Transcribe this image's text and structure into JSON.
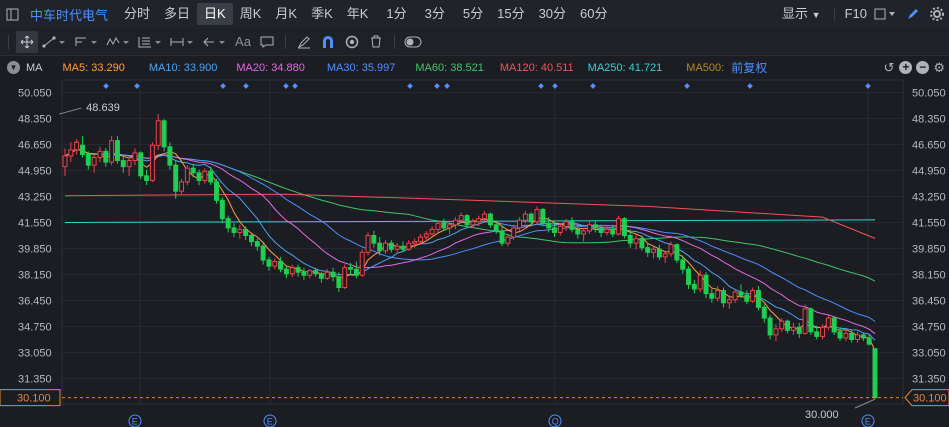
{
  "toolbar": {
    "stock_name": "中车时代电气",
    "periods": [
      "分时",
      "多日",
      "日K",
      "周K",
      "月K",
      "季K",
      "年K",
      "1分",
      "3分",
      "5分",
      "15分",
      "30分",
      "60分"
    ],
    "active_period": "日K",
    "display_label": "显示",
    "f10_label": "F10"
  },
  "ma_bar": {
    "label": "MA",
    "items": [
      {
        "text": "MA5: 33.290",
        "color": "#ff9f3a"
      },
      {
        "text": "MA10: 33.900",
        "color": "#4aa3f0"
      },
      {
        "text": "MA20: 34.880",
        "color": "#e36be3"
      },
      {
        "text": "MA30: 35.997",
        "color": "#4d90fe"
      },
      {
        "text": "MA60: 38.521",
        "color": "#3fc66b"
      },
      {
        "text": "MA120: 40.511",
        "color": "#f0545b"
      },
      {
        "text": "MA250: 41.721",
        "color": "#32d2d6"
      },
      {
        "text": "MA500:",
        "color": "#b18b2a"
      }
    ],
    "adjust_label": "前复权"
  },
  "colors": {
    "up": "#f0404a",
    "down": "#1fce52",
    "ma5": "#ff9f3a",
    "ma10": "#4aa3f0",
    "ma20": "#e36be3",
    "ma30": "#4d90fe",
    "ma60": "#3fc66b",
    "ma120": "#f0545b",
    "ma250": "#32d2d6",
    "accent": "#4d90fe"
  },
  "chart_data": {
    "type": "candlestick",
    "y_ticks": [
      "50.050",
      "48.350",
      "46.650",
      "44.950",
      "43.250",
      "41.550",
      "39.850",
      "38.150",
      "36.450",
      "34.750",
      "33.050",
      "31.350"
    ],
    "ylim": [
      29.5,
      50.6
    ],
    "current_price_label": "30.100",
    "current_price": 30.1,
    "max_label": "48.639",
    "max_value": 48.639,
    "min_label": "30.000",
    "min_value": 30.0,
    "events": [
      "E",
      "E",
      "Q",
      "E"
    ],
    "grid": true,
    "candles": [
      [
        45.2,
        46.4,
        44.6,
        45.9
      ],
      [
        45.9,
        46.8,
        45.5,
        46.3
      ],
      [
        46.3,
        47.0,
        46.0,
        46.8
      ],
      [
        46.6,
        47.2,
        45.8,
        46.0
      ],
      [
        46.0,
        46.2,
        45.0,
        45.3
      ],
      [
        45.3,
        46.0,
        44.8,
        45.8
      ],
      [
        45.8,
        46.5,
        45.5,
        46.2
      ],
      [
        46.2,
        46.4,
        45.2,
        45.5
      ],
      [
        45.5,
        47.2,
        45.3,
        46.9
      ],
      [
        46.9,
        47.2,
        45.4,
        45.6
      ],
      [
        45.6,
        46.0,
        44.8,
        45.2
      ],
      [
        45.2,
        45.8,
        44.6,
        45.6
      ],
      [
        45.6,
        46.4,
        45.3,
        46.1
      ],
      [
        46.1,
        46.2,
        44.4,
        44.6
      ],
      [
        44.6,
        45.0,
        44.0,
        44.3
      ],
      [
        44.3,
        46.8,
        44.2,
        46.6
      ],
      [
        46.6,
        48.64,
        46.3,
        48.2
      ],
      [
        48.2,
        48.3,
        46.2,
        46.5
      ],
      [
        46.5,
        46.8,
        45.0,
        45.3
      ],
      [
        45.3,
        45.6,
        43.1,
        43.6
      ],
      [
        43.6,
        44.4,
        43.4,
        44.2
      ],
      [
        44.2,
        45.3,
        44.0,
        45.1
      ],
      [
        45.1,
        45.4,
        44.5,
        44.8
      ],
      [
        44.8,
        45.0,
        44.0,
        44.3
      ],
      [
        44.3,
        45.1,
        44.1,
        44.9
      ],
      [
        44.9,
        45.2,
        44.0,
        44.2
      ],
      [
        44.2,
        44.4,
        42.8,
        43.0
      ],
      [
        43.0,
        43.2,
        41.5,
        41.8
      ],
      [
        41.8,
        42.0,
        40.9,
        41.2
      ],
      [
        41.2,
        41.5,
        40.6,
        40.9
      ],
      [
        40.9,
        41.4,
        40.5,
        41.1
      ],
      [
        41.1,
        41.3,
        40.4,
        40.7
      ],
      [
        40.7,
        40.9,
        40.0,
        40.3
      ],
      [
        40.3,
        40.5,
        39.7,
        40.0
      ],
      [
        40.0,
        40.2,
        38.8,
        39.1
      ],
      [
        39.1,
        39.3,
        38.4,
        38.7
      ],
      [
        38.7,
        39.2,
        38.5,
        39.0
      ],
      [
        39.0,
        39.3,
        38.3,
        38.5
      ],
      [
        38.5,
        38.7,
        37.9,
        38.2
      ],
      [
        38.2,
        38.8,
        38.0,
        38.6
      ],
      [
        38.6,
        38.8,
        38.0,
        38.3
      ],
      [
        38.3,
        38.6,
        37.8,
        38.1
      ],
      [
        38.1,
        38.5,
        37.9,
        38.4
      ],
      [
        38.4,
        38.6,
        38.0,
        38.2
      ],
      [
        38.2,
        38.3,
        37.6,
        37.9
      ],
      [
        37.9,
        38.5,
        37.8,
        38.3
      ],
      [
        38.3,
        38.6,
        37.7,
        38.0
      ],
      [
        38.0,
        38.3,
        37.0,
        37.3
      ],
      [
        37.3,
        38.8,
        37.2,
        38.6
      ],
      [
        38.6,
        38.9,
        38.2,
        38.5
      ],
      [
        38.5,
        39.0,
        37.9,
        38.1
      ],
      [
        38.1,
        39.8,
        38.0,
        39.6
      ],
      [
        39.6,
        40.9,
        39.4,
        40.7
      ],
      [
        40.7,
        41.0,
        39.9,
        40.2
      ],
      [
        40.2,
        40.6,
        39.4,
        39.7
      ],
      [
        39.7,
        40.4,
        39.5,
        40.2
      ],
      [
        40.2,
        40.4,
        39.6,
        39.8
      ],
      [
        39.8,
        40.2,
        39.5,
        40.0
      ],
      [
        40.0,
        40.3,
        39.6,
        39.8
      ],
      [
        39.8,
        40.4,
        39.7,
        40.2
      ],
      [
        40.2,
        40.5,
        39.9,
        40.3
      ],
      [
        40.3,
        40.8,
        40.1,
        40.6
      ],
      [
        40.6,
        41.0,
        40.3,
        40.8
      ],
      [
        40.8,
        41.3,
        40.6,
        41.1
      ],
      [
        41.1,
        41.7,
        40.9,
        41.5
      ],
      [
        41.5,
        41.8,
        41.0,
        41.2
      ],
      [
        41.2,
        41.6,
        40.8,
        41.4
      ],
      [
        41.4,
        41.9,
        41.1,
        41.7
      ],
      [
        41.7,
        42.2,
        41.5,
        42.0
      ],
      [
        42.0,
        42.1,
        41.2,
        41.4
      ],
      [
        41.4,
        41.8,
        41.2,
        41.6
      ],
      [
        41.6,
        42.0,
        41.3,
        41.8
      ],
      [
        41.8,
        42.3,
        41.6,
        42.1
      ],
      [
        42.1,
        42.2,
        41.2,
        41.4
      ],
      [
        41.4,
        41.7,
        40.8,
        41.0
      ],
      [
        41.0,
        41.3,
        40.0,
        40.2
      ],
      [
        40.2,
        40.8,
        40.0,
        40.6
      ],
      [
        40.6,
        41.4,
        40.4,
        41.2
      ],
      [
        41.2,
        41.9,
        41.0,
        41.7
      ],
      [
        41.7,
        42.3,
        41.5,
        42.1
      ],
      [
        42.1,
        42.2,
        41.4,
        41.6
      ],
      [
        41.6,
        42.6,
        41.4,
        42.4
      ],
      [
        42.4,
        42.5,
        41.3,
        41.5
      ],
      [
        41.5,
        41.9,
        40.9,
        41.2
      ],
      [
        41.2,
        41.6,
        40.6,
        40.9
      ],
      [
        40.9,
        41.5,
        40.7,
        41.3
      ],
      [
        41.3,
        41.8,
        41.0,
        41.6
      ],
      [
        41.6,
        41.9,
        40.9,
        41.1
      ],
      [
        41.1,
        41.4,
        40.5,
        40.8
      ],
      [
        40.8,
        41.2,
        40.3,
        41.0
      ],
      [
        41.0,
        41.6,
        40.8,
        41.4
      ],
      [
        41.4,
        41.7,
        40.9,
        41.2
      ],
      [
        41.2,
        41.4,
        40.6,
        40.9
      ],
      [
        40.9,
        41.3,
        40.7,
        41.1
      ],
      [
        41.1,
        41.4,
        40.6,
        40.8
      ],
      [
        40.8,
        42.0,
        40.7,
        41.8
      ],
      [
        41.8,
        41.9,
        40.5,
        40.7
      ],
      [
        40.7,
        41.1,
        39.9,
        40.2
      ],
      [
        40.2,
        40.8,
        39.8,
        40.5
      ],
      [
        40.5,
        40.7,
        39.7,
        39.9
      ],
      [
        39.9,
        40.2,
        39.3,
        39.6
      ],
      [
        39.6,
        40.0,
        39.2,
        39.8
      ],
      [
        39.8,
        40.1,
        39.1,
        39.3
      ],
      [
        39.3,
        39.7,
        38.9,
        39.5
      ],
      [
        39.5,
        40.3,
        39.3,
        40.1
      ],
      [
        40.1,
        40.2,
        38.9,
        39.1
      ],
      [
        39.1,
        39.4,
        38.2,
        38.5
      ],
      [
        38.5,
        38.7,
        37.2,
        37.5
      ],
      [
        37.5,
        37.8,
        36.9,
        37.2
      ],
      [
        37.2,
        38.4,
        37.0,
        38.1
      ],
      [
        38.1,
        38.3,
        36.6,
        36.9
      ],
      [
        36.9,
        37.2,
        36.3,
        36.6
      ],
      [
        36.6,
        37.4,
        36.4,
        37.1
      ],
      [
        37.1,
        37.3,
        36.0,
        36.3
      ],
      [
        36.3,
        36.8,
        35.9,
        36.5
      ],
      [
        36.5,
        37.2,
        36.3,
        37.0
      ],
      [
        37.0,
        37.5,
        36.6,
        36.8
      ],
      [
        36.8,
        37.1,
        36.2,
        36.4
      ],
      [
        36.4,
        37.3,
        36.3,
        37.1
      ],
      [
        37.1,
        37.4,
        35.8,
        36.0
      ],
      [
        36.0,
        36.2,
        35.0,
        35.3
      ],
      [
        35.3,
        35.5,
        33.9,
        34.2
      ],
      [
        34.2,
        34.9,
        33.8,
        34.6
      ],
      [
        34.6,
        35.3,
        34.4,
        35.1
      ],
      [
        35.1,
        35.2,
        34.3,
        34.5
      ],
      [
        34.5,
        35.0,
        34.2,
        34.7
      ],
      [
        34.7,
        35.0,
        34.0,
        34.3
      ],
      [
        34.3,
        36.2,
        34.2,
        35.9
      ],
      [
        35.9,
        36.0,
        34.2,
        34.4
      ],
      [
        34.4,
        34.8,
        33.9,
        34.1
      ],
      [
        34.1,
        34.9,
        33.9,
        34.7
      ],
      [
        34.7,
        35.5,
        34.5,
        35.3
      ],
      [
        35.3,
        35.4,
        34.2,
        34.4
      ],
      [
        34.4,
        34.7,
        33.8,
        34.0
      ],
      [
        34.0,
        34.5,
        33.8,
        34.3
      ],
      [
        34.3,
        34.5,
        33.7,
        33.9
      ],
      [
        33.9,
        34.4,
        33.7,
        34.2
      ],
      [
        34.2,
        34.3,
        33.8,
        34.0
      ],
      [
        34.0,
        34.2,
        33.5,
        33.6
      ],
      [
        33.3,
        33.3,
        30.0,
        30.1
      ]
    ]
  }
}
